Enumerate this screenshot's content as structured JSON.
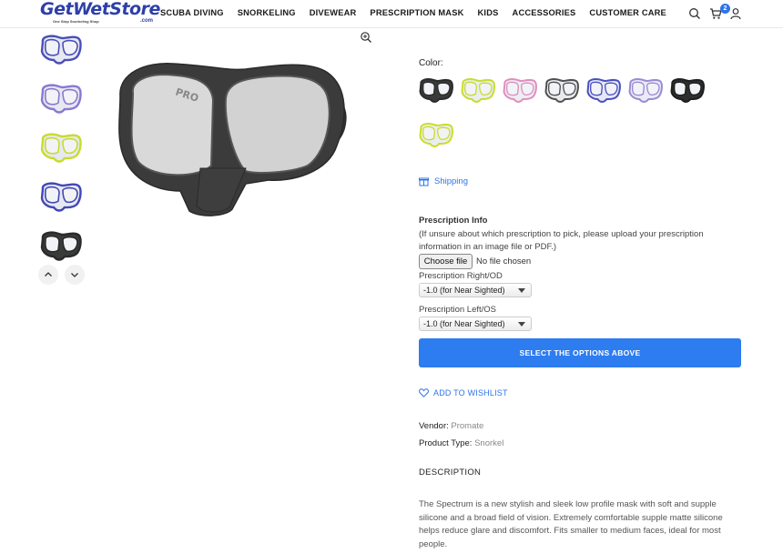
{
  "header": {
    "logo_text": "GetWetStore",
    "logo_tagline": "One Stop Snorkeling Shop",
    "logo_suffix": ".com",
    "nav": [
      "SCUBA DIVING",
      "SNORKELING",
      "DIVEWEAR",
      "PRESCRIPTION MASK",
      "KIDS",
      "ACCESSORIES",
      "CUSTOMER CARE"
    ],
    "cart_count": "2",
    "icons": [
      "search-icon",
      "cart-icon",
      "user-icon"
    ]
  },
  "gallery": {
    "thumbnails": [
      {
        "color": "#4a4fb8",
        "label": "purple"
      },
      {
        "color": "#8a78d0",
        "label": "lavender"
      },
      {
        "color": "#c9dc2a",
        "label": "yellow"
      },
      {
        "color": "#4248b4",
        "label": "blue"
      },
      {
        "color": "#2a2a2a",
        "label": "black"
      }
    ],
    "main_color": "#3a3a3a"
  },
  "product": {
    "color_label": "Color:",
    "swatches": [
      {
        "frame": "#2b2b2b",
        "skirt": "#3a3a3a"
      },
      {
        "frame": "#c8dc2e",
        "skirt": "#e8eef2"
      },
      {
        "frame": "#e08ec0",
        "skirt": "#eceef2"
      },
      {
        "frame": "#505050",
        "skirt": "#e8eaee"
      },
      {
        "frame": "#4a4fc0",
        "skirt": "#e6e8f4"
      },
      {
        "frame": "#9a8ad4",
        "skirt": "#eceaf6"
      },
      {
        "frame": "#1e1e1e",
        "skirt": "#2e2e2e"
      },
      {
        "frame": "#cbdd2a",
        "skirt": "#e9eef3"
      }
    ],
    "shipping_label": "Shipping",
    "prescription_title": "Prescription Info",
    "prescription_desc": "(If unsure about which prescription to pick, please upload your prescription information in an image file or PDF.)",
    "file_button": "Choose file",
    "file_status": "No file chosen",
    "right_label": "Prescription Right/OD",
    "right_value": "-1.0 (for Near Sighted)",
    "left_label": "Prescription Left/OS",
    "left_value": "-1.0 (for Near Sighted)",
    "cta_label": "SELECT THE OPTIONS ABOVE",
    "wishlist_label": "ADD TO WISHLIST",
    "vendor_label": "Vendor:",
    "vendor_value": "Promate",
    "type_label": "Product Type:",
    "type_value": "Snorkel",
    "description_title": "DESCRIPTION",
    "description": "The Spectrum is a new stylish and sleek low profile mask with soft and supple silicone and a broad field of vision. Extremely comfortable supple matte silicone helps reduce glare and discomfort. Fits smaller to medium faces, ideal for most people."
  },
  "colors": {
    "accent": "#2d7cf0",
    "brand": "#2d3fa8"
  }
}
